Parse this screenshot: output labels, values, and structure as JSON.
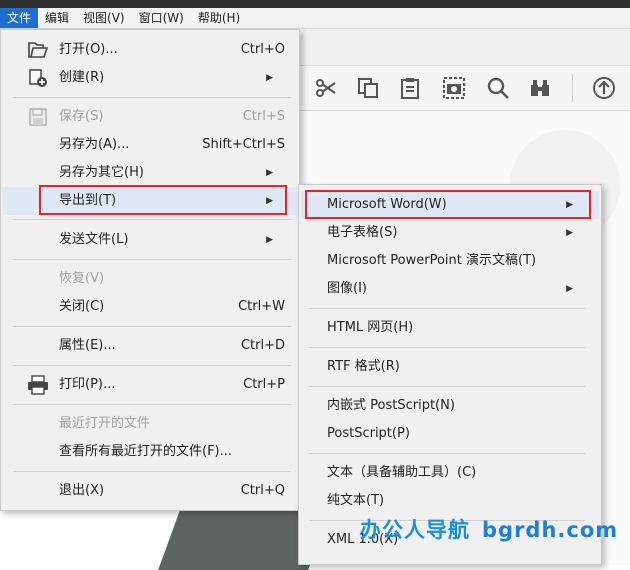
{
  "menubar": {
    "items": [
      {
        "label": "文件",
        "active": true
      },
      {
        "label": "编辑"
      },
      {
        "label": "视图(V)"
      },
      {
        "label": "窗口(W)"
      },
      {
        "label": "帮助(H)"
      }
    ]
  },
  "file_menu": {
    "open": {
      "label": "打开(O)...",
      "shortcut": "Ctrl+O"
    },
    "create": {
      "label": "创建(R)"
    },
    "save": {
      "label": "保存(S)",
      "shortcut": "Ctrl+S"
    },
    "save_as": {
      "label": "另存为(A)...",
      "shortcut": "Shift+Ctrl+S"
    },
    "save_as_other": {
      "label": "另存为其它(H)"
    },
    "export_to": {
      "label": "导出到(T)"
    },
    "send_file": {
      "label": "发送文件(L)"
    },
    "revert": {
      "label": "恢复(V)"
    },
    "close": {
      "label": "关闭(C)",
      "shortcut": "Ctrl+W"
    },
    "properties": {
      "label": "属性(E)...",
      "shortcut": "Ctrl+D"
    },
    "print": {
      "label": "打印(P)...",
      "shortcut": "Ctrl+P"
    },
    "recent_files": {
      "label": "最近打开的文件"
    },
    "view_all_recent": {
      "label": "查看所有最近打开的文件(F)..."
    },
    "exit": {
      "label": "退出(X)",
      "shortcut": "Ctrl+Q"
    }
  },
  "export_submenu": {
    "word": {
      "label": "Microsoft Word(W)"
    },
    "spreadsheet": {
      "label": "电子表格(S)"
    },
    "powerpoint": {
      "label": "Microsoft PowerPoint 演示文稿(T)"
    },
    "image": {
      "label": "图像(I)"
    },
    "html": {
      "label": "HTML 网页(H)"
    },
    "rtf": {
      "label": "RTF 格式(R)"
    },
    "eps": {
      "label": "内嵌式 PostScript(N)"
    },
    "postscript": {
      "label": "PostScript(P)"
    },
    "text_accessible": {
      "label": "文本（具备辅助工具）(C)"
    },
    "plain_text": {
      "label": "纯文本(T)"
    },
    "xml": {
      "label": "XML 1.0(X)"
    }
  },
  "watermark": {
    "brand": "办公人导航",
    "site": "bgrdh.com"
  },
  "colors": {
    "highlight": "#e3262b",
    "menu_active": "#1c6fd1",
    "hover": "#dfe9f5",
    "watermark": "#1a8fe0"
  },
  "toolbar_icons": [
    "scissors-icon",
    "copy-icon",
    "clipboard-icon",
    "camera-icon",
    "search-icon",
    "binoculars-icon",
    "upload-icon",
    "download-icon"
  ]
}
